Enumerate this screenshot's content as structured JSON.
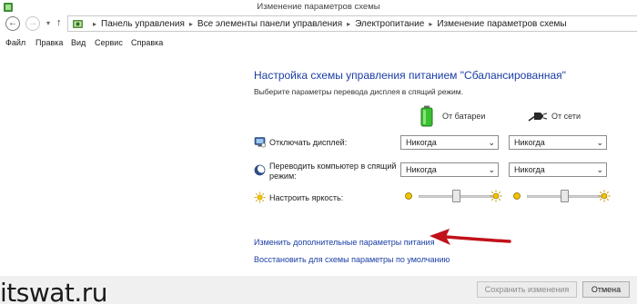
{
  "window": {
    "title": "Изменение параметров схемы"
  },
  "nav": {
    "back_glyph": "←",
    "forward_glyph": "→",
    "dropdown_glyph": "▾",
    "up_glyph": "↑",
    "breadcrumbs": [
      "Панель управления",
      "Все элементы панели управления",
      "Электропитание",
      "Изменение параметров схемы"
    ],
    "separator": "▸"
  },
  "menu": [
    "Файл",
    "Правка",
    "Вид",
    "Сервис",
    "Справка"
  ],
  "main": {
    "heading": "Настройка схемы управления питанием \"Сбалансированная\"",
    "subheading": "Выберите параметры перевода дисплея в спящий режим.",
    "columns": {
      "battery": "От батареи",
      "ac": "От сети"
    },
    "rows": {
      "display": {
        "label": "Отключать дисплей:",
        "battery": "Никогда",
        "ac": "Никогда"
      },
      "sleep": {
        "label_line1": "Переводить компьютер в спящий",
        "label_line2": "режим:",
        "battery": "Никогда",
        "ac": "Никогда"
      },
      "brightness": {
        "label": "Настроить яркость:",
        "battery_level": 0.5,
        "ac_level": 0.5
      }
    },
    "links": {
      "advanced": "Изменить дополнительные параметры питания",
      "restore": "Восстановить для схемы параметры по умолчанию"
    }
  },
  "footer": {
    "watermark": "itswat.ru",
    "save": "Сохранить изменения",
    "cancel": "Отмена"
  },
  "colors": {
    "link": "#1a3ea5",
    "arrow": "#c0121b",
    "battery": "#2fb52c"
  },
  "icons": [
    "control-panel-icon",
    "monitor-icon",
    "moon-icon",
    "sun-icon",
    "battery-icon",
    "plug-icon"
  ]
}
